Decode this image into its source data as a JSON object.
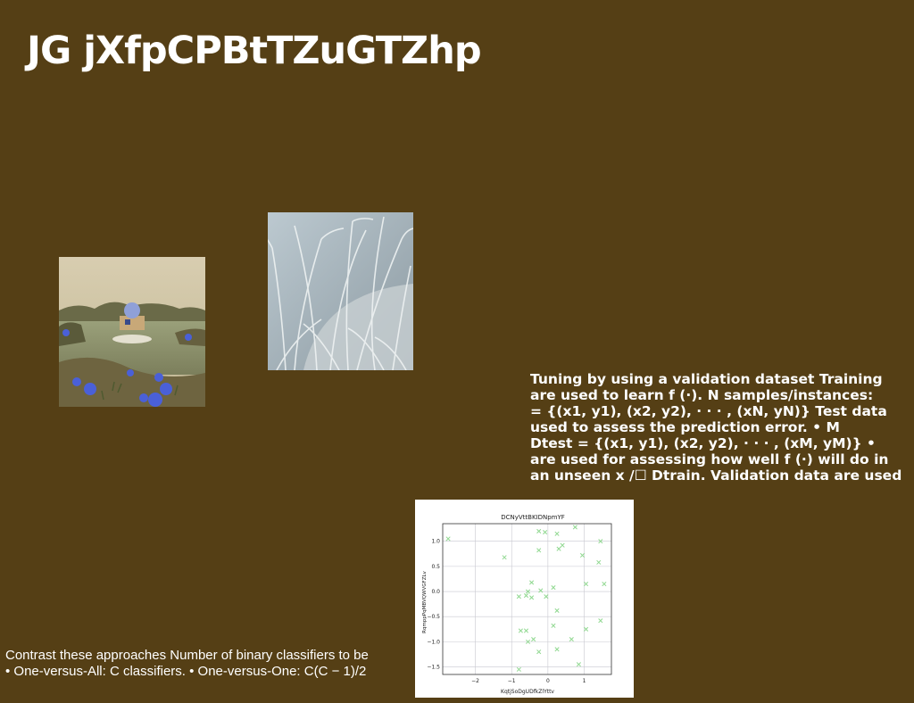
{
  "slide": {
    "title": "JG jXfpCPBtTZuGTZhp",
    "paragraph_lines": [
      "Tuning by using a validation dataset Training",
      "are used to learn f (·). N samples/instances:",
      "= {(x1, y1), (x2, y2), · · · , (xN, yN)} Test data",
      "used to assess the prediction error. • M",
      "Dtest = {(x1, y1), (x2, y2), · · · , (xM, yM)} •",
      "are used for assessing how well f (·) will do in",
      "an unseen x /☐ Dtrain. Validation data are used"
    ],
    "bottom_lines": [
      "Contrast these approaches Number of binary classifiers to be",
      "• One-versus-All: C classifiers. • One-versus-One: C(C − 1)/2"
    ]
  },
  "colors": {
    "background": "#553f15",
    "text": "#ffffff",
    "marker": "#90d890"
  },
  "chart_data": {
    "type": "scatter",
    "title": "DCNyVttBKIDNpmYF",
    "xlabel": "KqtjSoDgUDfkZlYttv",
    "ylabel": "RqmppPqMBVQWVGFZLv",
    "xlim": [
      -2.9,
      1.75
    ],
    "ylim": [
      -1.65,
      1.35
    ],
    "xticks": [
      -2,
      -1,
      0,
      1
    ],
    "xtick_labels": [
      "−2",
      "−1",
      "0",
      "1"
    ],
    "yticks": [
      1.0,
      0.5,
      0.0,
      -0.5,
      -1.0,
      -1.5
    ],
    "ytick_labels": [
      "1.0",
      "0.5",
      "0.0",
      "−0.5",
      "−1.0",
      "−1.5"
    ],
    "grid": true,
    "marker": "x",
    "points": [
      [
        -2.75,
        1.05
      ],
      [
        -1.2,
        0.68
      ],
      [
        -0.25,
        1.2
      ],
      [
        -0.08,
        1.18
      ],
      [
        0.25,
        1.15
      ],
      [
        0.75,
        1.28
      ],
      [
        -0.25,
        0.82
      ],
      [
        0.3,
        0.85
      ],
      [
        0.4,
        0.92
      ],
      [
        0.95,
        0.72
      ],
      [
        1.45,
        1.0
      ],
      [
        1.4,
        0.58
      ],
      [
        1.05,
        0.15
      ],
      [
        1.55,
        0.15
      ],
      [
        -0.45,
        0.18
      ],
      [
        -0.55,
        0.0
      ],
      [
        -0.8,
        -0.1
      ],
      [
        -0.6,
        -0.08
      ],
      [
        -0.45,
        -0.12
      ],
      [
        -0.2,
        0.02
      ],
      [
        -0.05,
        -0.1
      ],
      [
        0.15,
        0.08
      ],
      [
        0.25,
        -0.38
      ],
      [
        0.15,
        -0.68
      ],
      [
        -0.75,
        -0.78
      ],
      [
        -0.6,
        -0.78
      ],
      [
        -0.55,
        -1.0
      ],
      [
        -0.4,
        -0.95
      ],
      [
        -0.25,
        -1.2
      ],
      [
        0.25,
        -1.15
      ],
      [
        0.65,
        -0.95
      ],
      [
        1.05,
        -0.75
      ],
      [
        1.45,
        -0.58
      ],
      [
        0.85,
        -1.45
      ],
      [
        -0.8,
        -1.55
      ]
    ]
  }
}
